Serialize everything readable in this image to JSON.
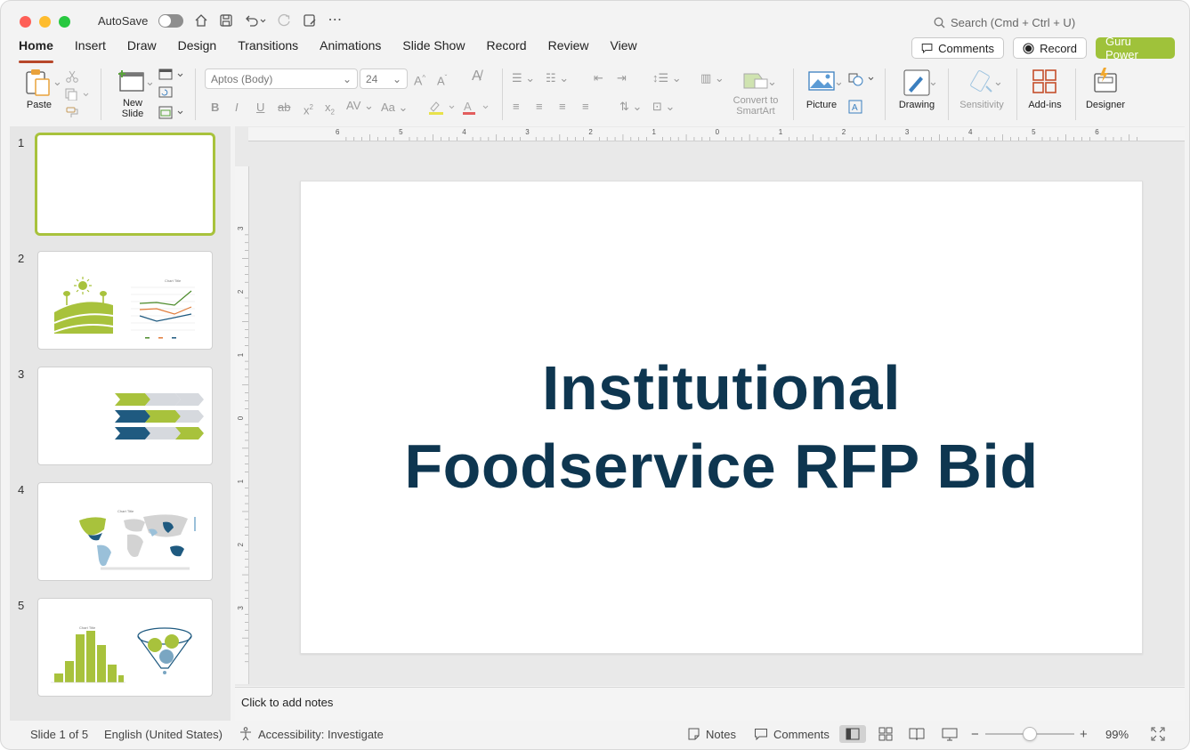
{
  "titlebar": {
    "autosave_label": "AutoSave",
    "search_placeholder": "Search (Cmd + Ctrl + U)"
  },
  "tabs": [
    "Home",
    "Insert",
    "Draw",
    "Design",
    "Transitions",
    "Animations",
    "Slide Show",
    "Record",
    "Review",
    "View"
  ],
  "tabs_right": {
    "comments": "Comments",
    "record": "Record",
    "guru": "Guru Power"
  },
  "ribbon": {
    "paste": "Paste",
    "new_slide_1": "New",
    "new_slide_2": "Slide",
    "font_name": "Aptos (Body)",
    "font_size": "24",
    "convert_1": "Convert to",
    "convert_2": "SmartArt",
    "picture": "Picture",
    "drawing": "Drawing",
    "sensitivity": "Sensitivity",
    "addins": "Add-ins",
    "designer": "Designer"
  },
  "thumbnails": [
    "1",
    "2",
    "3",
    "4",
    "5"
  ],
  "thumbnail_chart_title": "Chart Title",
  "slide": {
    "title_line1": "Institutional",
    "title_line2": "Foodservice RFP Bid"
  },
  "notes_placeholder": "Click to add notes",
  "ruler_h": [
    "6",
    "5",
    "4",
    "3",
    "2",
    "1",
    "0",
    "1",
    "2",
    "3",
    "4",
    "5",
    "6"
  ],
  "ruler_v": [
    "3",
    "2",
    "1",
    "0",
    "1",
    "2",
    "3"
  ],
  "status": {
    "slide_count": "Slide 1 of 5",
    "language": "English (United States)",
    "accessibility": "Accessibility: Investigate",
    "notes": "Notes",
    "comments": "Comments",
    "zoom": "99%"
  },
  "colors": {
    "accent_green": "#a8c23c",
    "navy": "#0e3650",
    "tab_underline": "#b7472a",
    "teal_blue": "#1f5a80"
  }
}
